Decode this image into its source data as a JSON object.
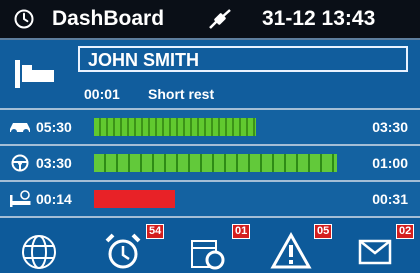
{
  "header": {
    "title": "DashBoard",
    "datetime": "31-12 13:43",
    "icon": "clock-icon",
    "status_icon": "connection-icon"
  },
  "driver": {
    "name": "JOHN SMITH",
    "activity_time": "00:01",
    "activity_label": "Short rest",
    "icon": "bed-icon"
  },
  "rows": [
    {
      "icon": "driving-icon",
      "left_value": "05:30",
      "right_value": "03:30",
      "bar_fill_fraction": 0.52,
      "bar_color": "green"
    },
    {
      "icon": "steering-wheel-icon",
      "left_value": "03:30",
      "right_value": "01:00",
      "bar_fill_fraction": 0.78,
      "bar_color": "green"
    },
    {
      "icon": "rest-bed-icon",
      "left_value": "00:14",
      "right_value": "00:31",
      "bar_fill_fraction": 0.26,
      "bar_color": "red"
    }
  ],
  "footer": {
    "items": [
      {
        "name": "globe-icon",
        "badge": ""
      },
      {
        "name": "alarm-clock-icon",
        "badge": "54"
      },
      {
        "name": "calendar-settings-icon",
        "badge": "01"
      },
      {
        "name": "warning-icon",
        "badge": "05"
      },
      {
        "name": "envelope-icon",
        "badge": "02"
      }
    ]
  },
  "colors": {
    "header": "#0a0f17",
    "panel": "#115d9d",
    "green": "#61c92f",
    "red": "#e82227",
    "badge": "#d41e1e"
  }
}
